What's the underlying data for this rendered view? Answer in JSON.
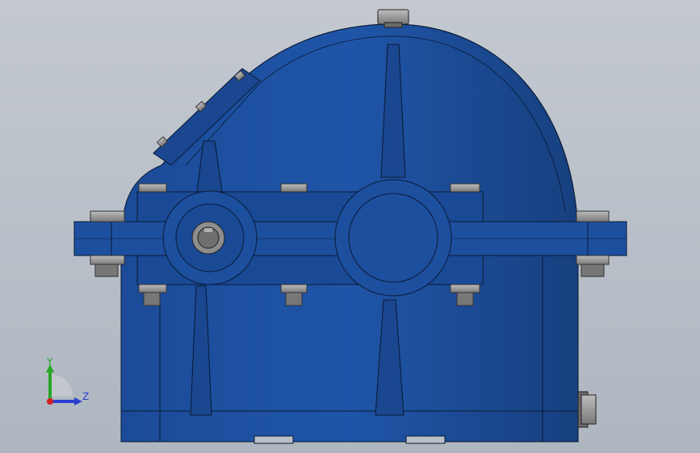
{
  "triad": {
    "y_label": "Y",
    "z_label": "Z",
    "y_color": "#26a626",
    "z_color": "#2a3fd0",
    "origin_color": "#d02020"
  },
  "model": {
    "body_color": "#1d4f9f",
    "edge_color": "#0a1a33",
    "bolt_color": "#8e8e8e",
    "background_top": "#c4c9d0",
    "background_bottom": "#aeb6c0"
  }
}
